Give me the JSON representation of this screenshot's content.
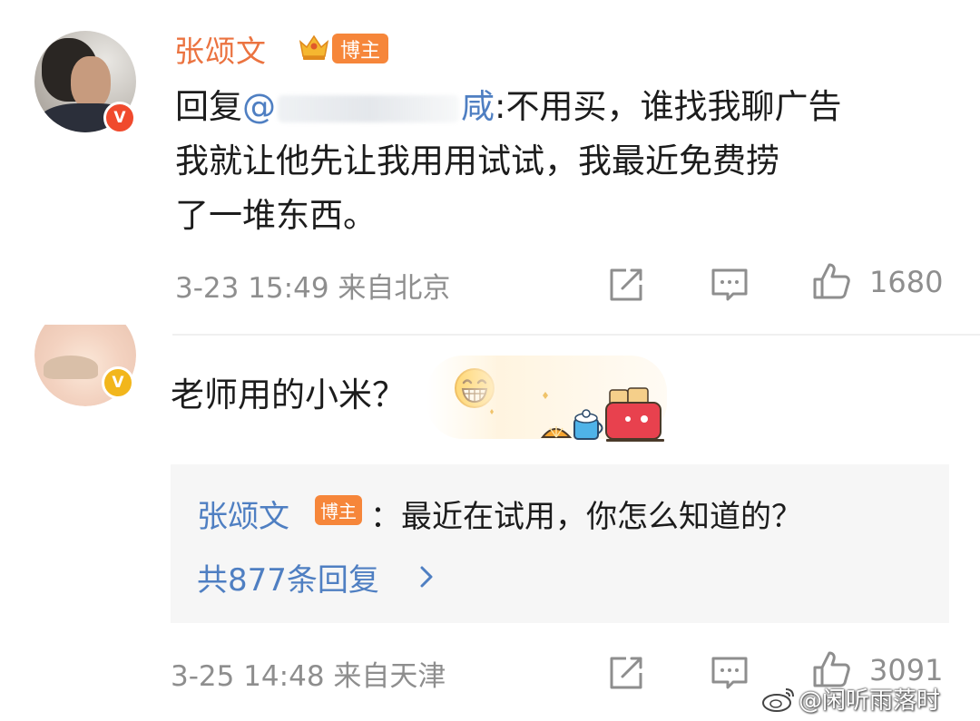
{
  "comments": [
    {
      "username": "张颂文",
      "badge": "博主",
      "text_lines": [
        {
          "prefix": "回复",
          "mention_start": "@",
          "mention_end": "咸",
          "rest": ":不用买，谁找我聊广告"
        },
        {
          "text": "我就让他先让我用用试试，我最近免费捞"
        },
        {
          "text": "了一堆东西。"
        }
      ],
      "time": "3-23 15:49",
      "location": "来自北京",
      "likes": "1680"
    },
    {
      "text": "老师用的小米？",
      "emoji": "grin-emoji",
      "reply": {
        "author": "张颂文",
        "badge": "博主",
        "text": "：最近在试用，你怎么知道的？",
        "count_label": "共877条回复"
      },
      "time": "3-25 14:48",
      "location": "来自天津",
      "likes": "3091"
    }
  ],
  "watermark": "@闲听雨落时",
  "colors": {
    "username": "#eb7340",
    "link": "#4f7fc2",
    "badge": "#f6863a",
    "verified_red": "#f04a2d",
    "verified_gold": "#f2b61c",
    "meta": "#8e8e8e"
  }
}
